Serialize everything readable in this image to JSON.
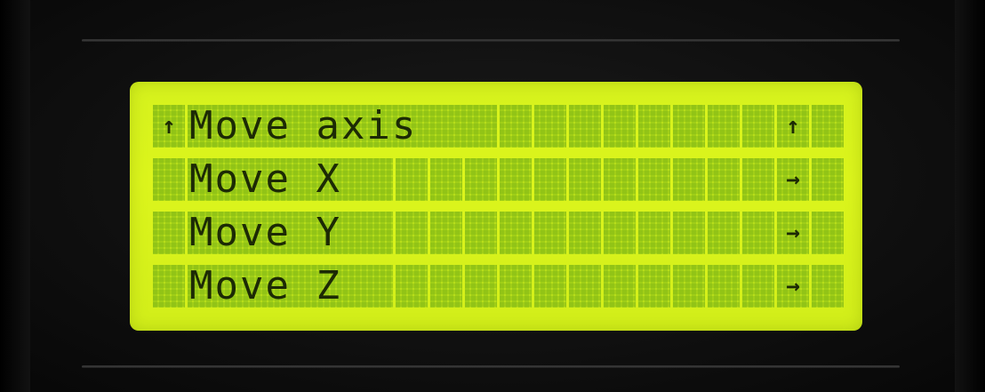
{
  "screen": {
    "rows": [
      {
        "text": "Move axis",
        "leading_marker": "↑",
        "trailing_icon": "↑"
      },
      {
        "text": "Move X",
        "leading_marker": "",
        "trailing_icon": "→"
      },
      {
        "text": "Move Y",
        "leading_marker": "",
        "trailing_icon": "→"
      },
      {
        "text": "Move Z",
        "leading_marker": "",
        "trailing_icon": "→"
      }
    ]
  },
  "icons": {
    "row0_trailing": "up-arrow-icon",
    "row1_trailing": "right-arrow-icon",
    "row2_trailing": "right-arrow-icon",
    "row3_trailing": "right-arrow-icon"
  },
  "colors": {
    "lcd_background": "#d6f21d",
    "lcd_text": "#1c2a05",
    "bezel": "#101010"
  }
}
